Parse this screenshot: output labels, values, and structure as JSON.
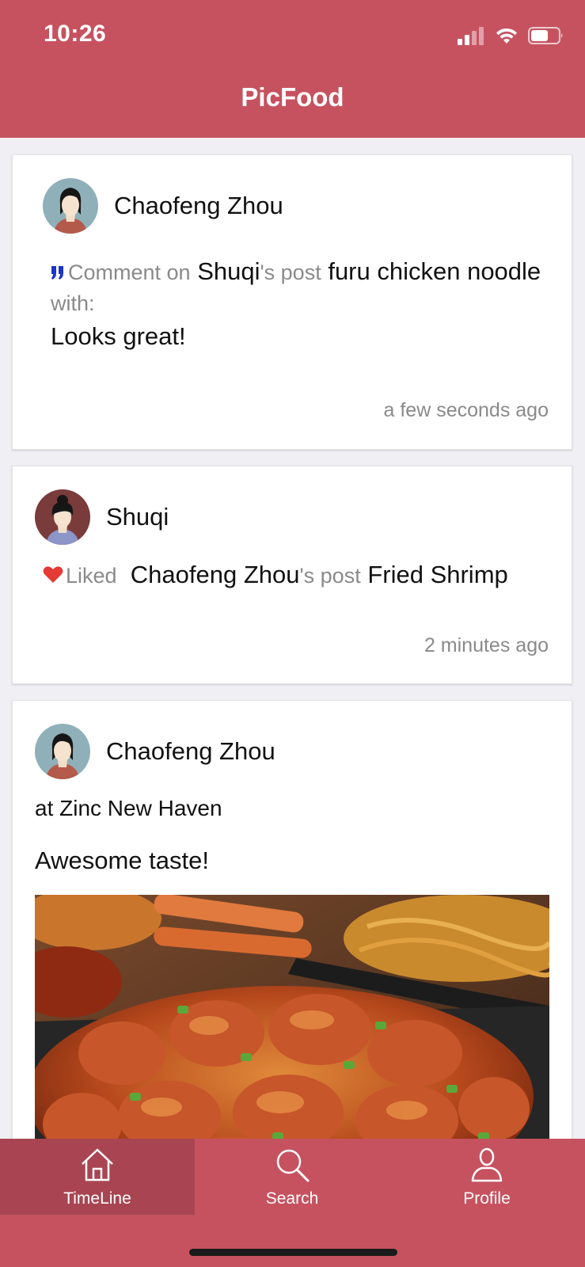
{
  "status_bar": {
    "time": "10:26"
  },
  "app": {
    "title": "PicFood"
  },
  "feed": [
    {
      "user": "Chaofeng Zhou",
      "prefix": "Comment on",
      "target_user": "Shuqi",
      "possessive": "'s post",
      "post": "furu chicken noodle",
      "suffix": "with:",
      "comment": "Looks great!",
      "time": "a few seconds ago"
    },
    {
      "user": "Shuqi",
      "prefix": "Liked",
      "target_user": "Chaofeng Zhou",
      "possessive": "'s post",
      "post": "Fried Shrimp",
      "time": "2 minutes ago"
    },
    {
      "user": "Chaofeng Zhou",
      "location": "at Zinc New Haven",
      "caption": "Awesome taste!"
    }
  ],
  "tabs": [
    {
      "label": "TimeLine",
      "icon": "home-icon"
    },
    {
      "label": "Search",
      "icon": "search-icon"
    },
    {
      "label": "Profile",
      "icon": "profile-icon"
    }
  ],
  "colors": {
    "brand": "#c65260",
    "active_tab": "#a94552",
    "like": "#e53935",
    "quote": "#1a35c8"
  }
}
